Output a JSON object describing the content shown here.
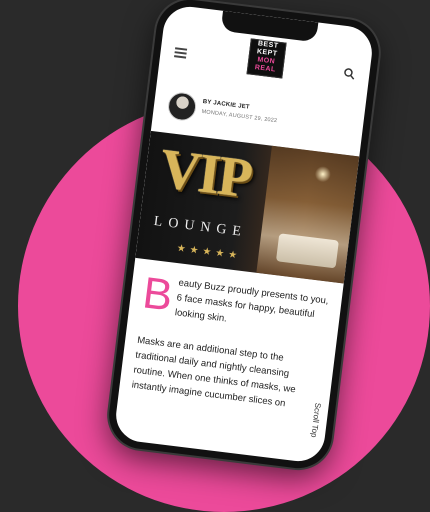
{
  "header": {
    "logo_lines": [
      "BEST",
      "KEPT",
      "MON",
      "REAL"
    ]
  },
  "author": {
    "byline": "BY JACKIE JET",
    "date": "MONDAY, AUGUST 29, 2022"
  },
  "hero": {
    "title": "VIP",
    "subtitle": "LOUNGE",
    "stars": "★★★★★"
  },
  "article": {
    "dropcap": "B",
    "lead": "eauty Buzz proudly presents to you, 6 face masks for happy, beautiful looking skin.",
    "body": "Masks are an additional step to the traditional daily and nightly cleansing routine. When one thinks of masks, we instantly imagine cucumber slices on"
  },
  "scroll_top_label": "Scroll Top",
  "colors": {
    "accent": "#ec4a9a",
    "background": "#2a2a2a"
  }
}
